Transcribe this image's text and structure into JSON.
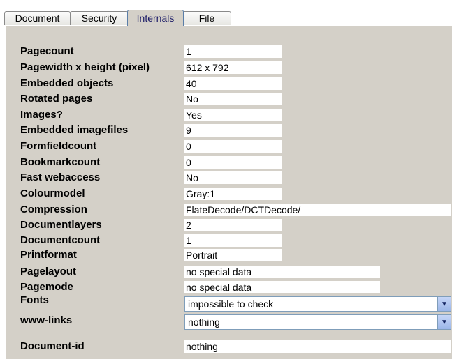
{
  "tabs": [
    "Document",
    "Security",
    "Internals",
    "File"
  ],
  "active_tab": "Internals",
  "fields": {
    "pagecount": {
      "label": "Pagecount",
      "value": "1"
    },
    "pagesize": {
      "label": "Pagewidth x height (pixel)",
      "value": "612 x 792"
    },
    "embedded_objects": {
      "label": "Embedded objects",
      "value": "40"
    },
    "rotated_pages": {
      "label": "Rotated pages",
      "value": "No"
    },
    "images": {
      "label": "Images?",
      "value": "Yes"
    },
    "embedded_imagefiles": {
      "label": "Embedded imagefiles",
      "value": "9"
    },
    "formfieldcount": {
      "label": "Formfieldcount",
      "value": "0"
    },
    "bookmarkcount": {
      "label": "Bookmarkcount",
      "value": "0"
    },
    "fast_webaccess": {
      "label": "Fast webaccess",
      "value": "No"
    },
    "colourmodel": {
      "label": "Colourmodel",
      "value": "Gray:1"
    },
    "compression": {
      "label": "Compression",
      "value": "FlateDecode/DCTDecode/"
    },
    "documentlayers": {
      "label": "Documentlayers",
      "value": "2"
    },
    "documentcount": {
      "label": "Documentcount",
      "value": "1"
    },
    "printformat": {
      "label": "Printformat",
      "value": "Portrait"
    },
    "pagelayout": {
      "label": "Pagelayout",
      "value": "no special data"
    },
    "pagemode": {
      "label": "Pagemode",
      "value": "no special data"
    },
    "fonts": {
      "label": "Fonts",
      "value": "impossible to check"
    },
    "www_links": {
      "label": "www-links",
      "value": "nothing"
    },
    "document_id": {
      "label": "Document-id",
      "value": "nothing"
    }
  }
}
